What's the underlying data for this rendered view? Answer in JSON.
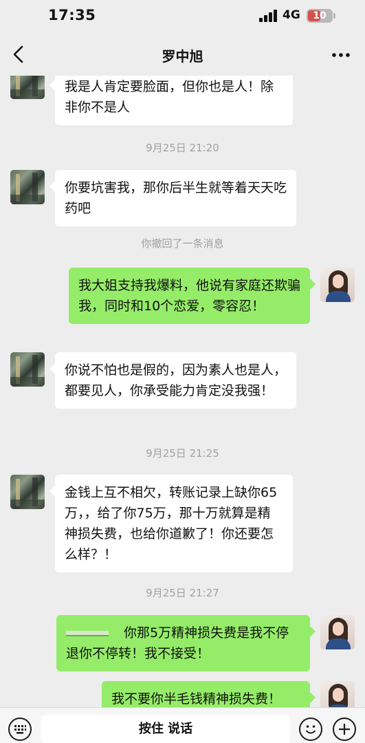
{
  "status_bar": {
    "time": "17:35",
    "network": "4G",
    "battery": "10",
    "battery_color": "#d3534c"
  },
  "nav": {
    "title": "罗中旭",
    "back_icon": "chevron-left-icon",
    "more_icon": "more-horizontal-icon"
  },
  "messages": [
    {
      "side": "in",
      "text": "我是人肯定要脸面，但你也是人！除非你不是人"
    },
    {
      "type": "time",
      "text": "9月25日 21:20"
    },
    {
      "side": "in",
      "text": "你要坑害我，那你后半生就等着天天吃药吧"
    },
    {
      "type": "system",
      "text": "你撤回了一条消息"
    },
    {
      "side": "out",
      "text": "我大姐支持我爆料，他说有家庭还欺骗我，同时和10个恋爱，零容忍！"
    },
    {
      "side": "in",
      "text": "你说不怕也是假的，因为素人也是人，都要见人，你承受能力肯定没我强！"
    },
    {
      "type": "time",
      "text": "9月25日 21:25"
    },
    {
      "side": "in",
      "text": "金钱上互不相欠，转账记录上缺你65万，，给了你75万，那十万就算是精神损失费，也给你道歉了！你还要怎么样？！"
    },
    {
      "type": "time",
      "text": "9月25日 21:27"
    },
    {
      "side": "out",
      "text": "你那5万精神损失费是我不停退你不停转！我不接受！"
    },
    {
      "side": "out",
      "text": "我不要你半毛钱精神损失费！"
    }
  ],
  "input_bar": {
    "hold_to_talk_label": "按住 说话",
    "voice_keyboard_icon": "keyboard-icon",
    "emoji_icon": "emoji-icon",
    "plus_icon": "plus-icon"
  },
  "colors": {
    "outgoing_bubble": "#95ec69",
    "incoming_bubble": "#ffffff",
    "background": "#ededed"
  }
}
